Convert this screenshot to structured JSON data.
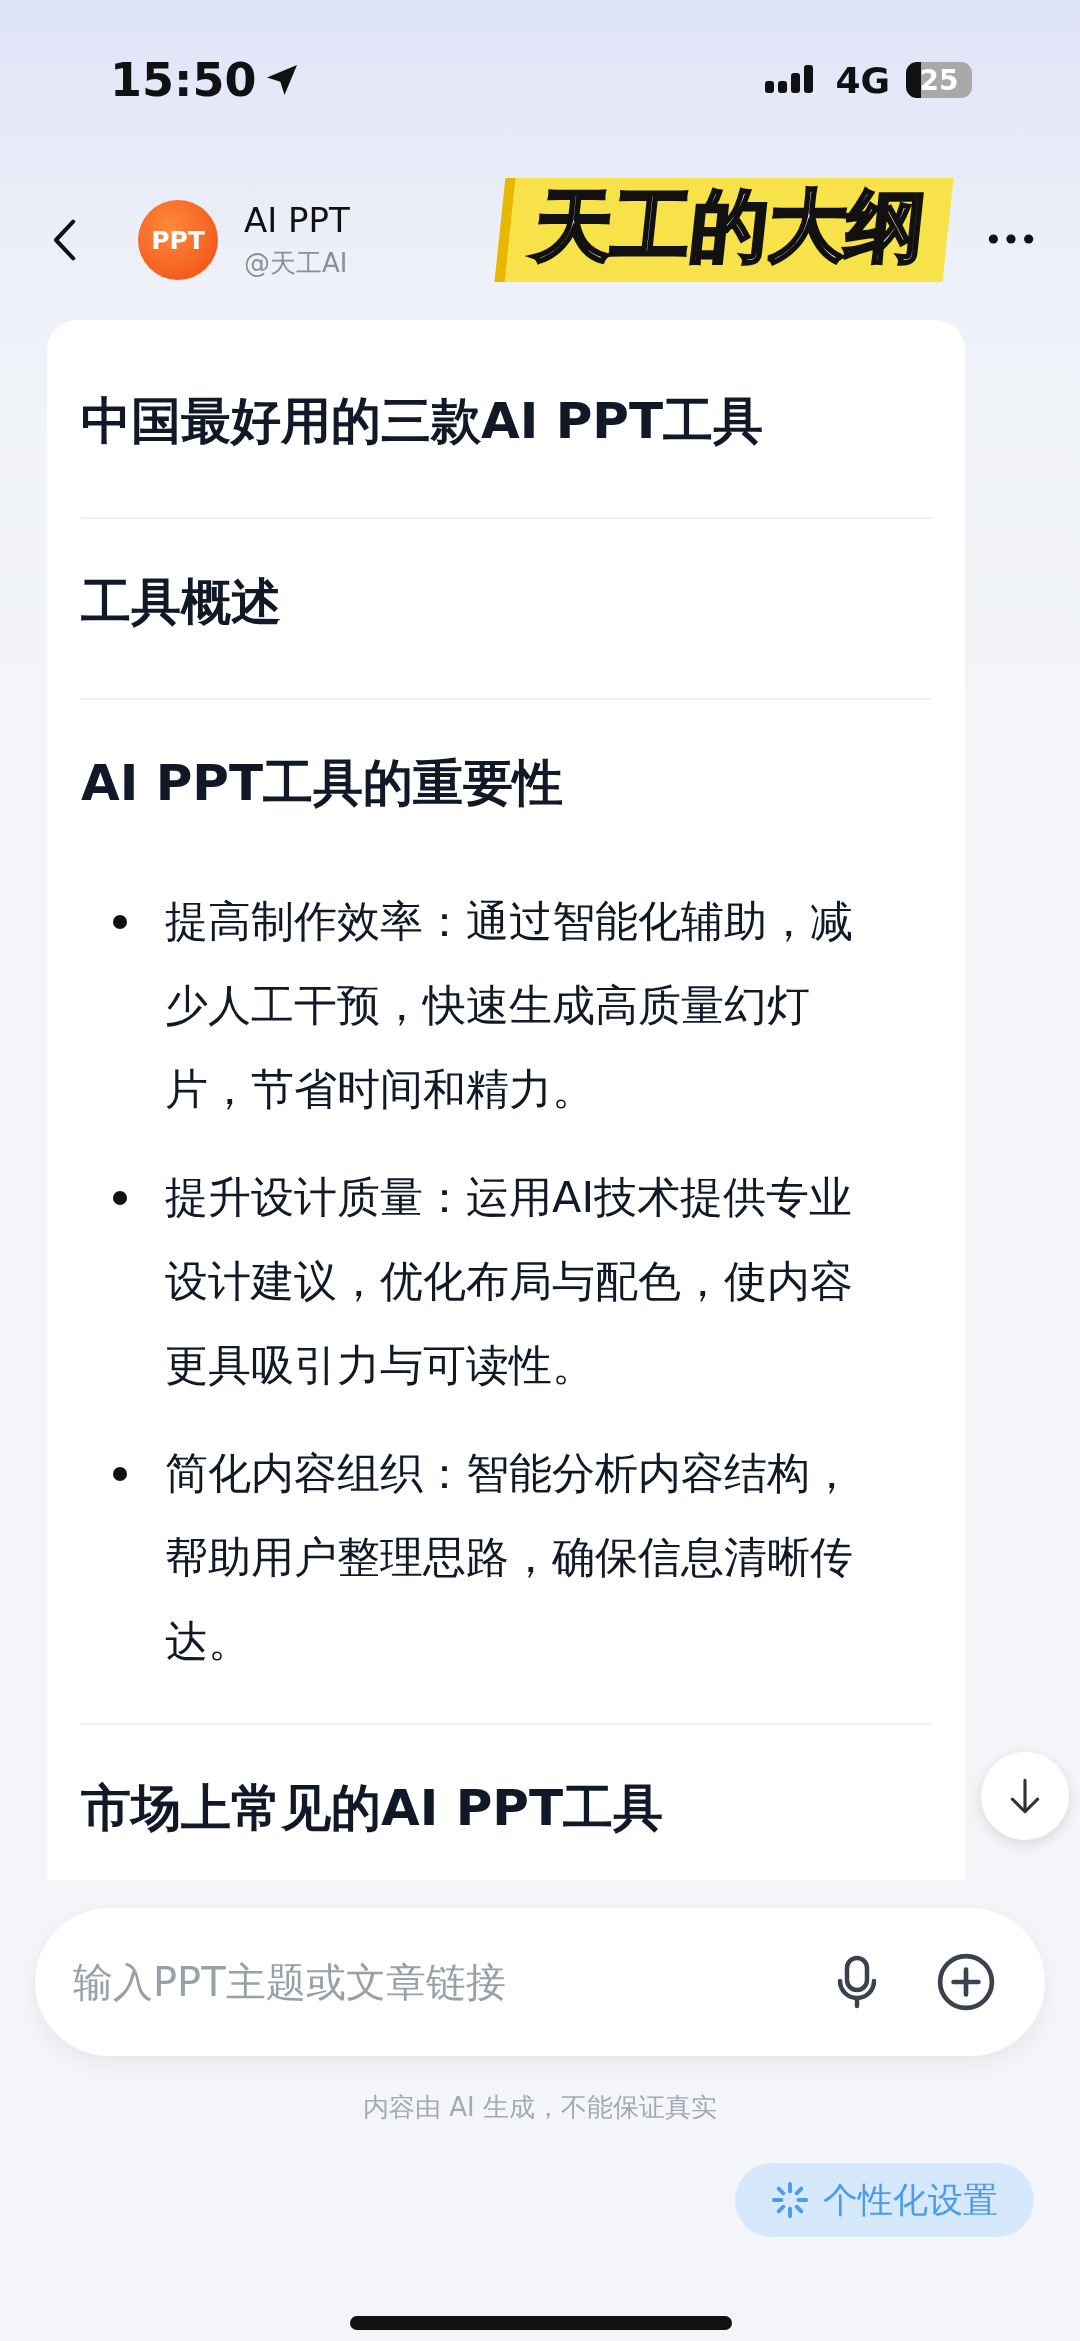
{
  "status_bar": {
    "time": "15:50",
    "network": "4G",
    "battery": "25"
  },
  "header": {
    "avatar": "PPT",
    "title": "AI PPT",
    "handle": "@天工AI"
  },
  "sticker": "天工的大纲",
  "outline": [
    {
      "kind": "heading",
      "text": "中国最好用的三款AI PPT工具"
    },
    {
      "kind": "heading",
      "text": "工具概述"
    },
    {
      "kind": "subheading",
      "text": "AI PPT工具的重要性",
      "items": [
        "提高制作效率：通过智能化辅助，减少人工干预，快速生成高质量幻灯片，节省时间和精力。",
        "提升设计质量：运用AI技术提供专业设计建议，优化布局与配色，使内容更具吸引力与可读性。",
        "简化内容组织：智能分析内容结构，帮助用户整理思路，确保信息清晰传达。"
      ]
    },
    {
      "kind": "heading",
      "text": "市场上常见的AI PPT工具"
    }
  ],
  "input": {
    "placeholder": "输入PPT主题或文章链接"
  },
  "disclaimer": "内容由 AI 生成，不能保证真实",
  "settings_button": "个性化设置"
}
